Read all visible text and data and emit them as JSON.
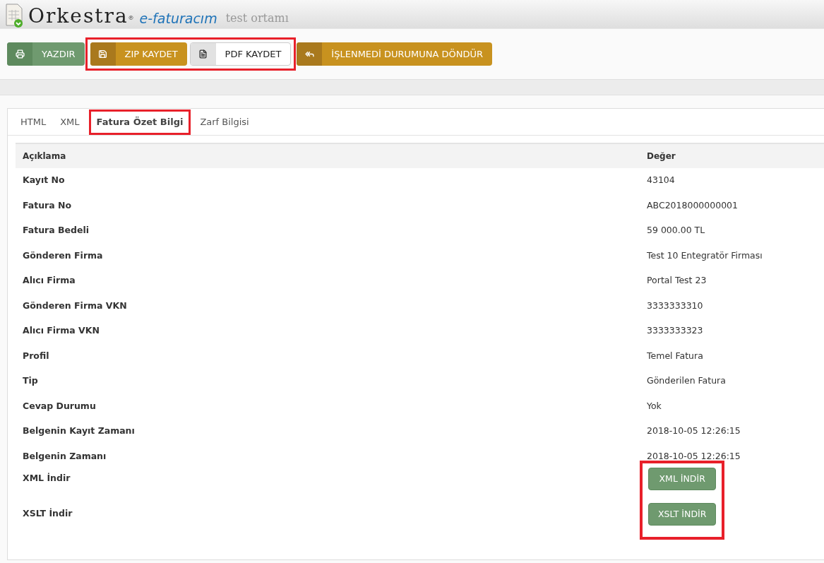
{
  "header": {
    "logo": "Orkestra",
    "logo_mark": "®",
    "product": "e-faturacım",
    "environment": "test ortamı"
  },
  "toolbar": [
    {
      "label": "YAZDIR",
      "kind": "print",
      "highlighted": false
    },
    {
      "label": "ZIP KAYDET",
      "kind": "save",
      "highlighted": true
    },
    {
      "label": "PDF KAYDET",
      "kind": "pdf",
      "highlighted": true
    },
    {
      "label": "İŞLENMEDİ DURUMUNA DÖNDÜR",
      "kind": "revert",
      "highlighted": false
    }
  ],
  "tabs": [
    {
      "label": "HTML",
      "selected": false,
      "highlighted": false
    },
    {
      "label": "XML",
      "selected": false,
      "highlighted": false
    },
    {
      "label": "Fatura Özet Bilgi",
      "selected": true,
      "highlighted": true
    },
    {
      "label": "Zarf Bilgisi",
      "selected": false,
      "highlighted": false
    }
  ],
  "table": {
    "columns": [
      "Açıklama",
      "Değer"
    ],
    "rows": [
      [
        "Kayıt No",
        "43104"
      ],
      [
        "Fatura No",
        "ABC2018000000001"
      ],
      [
        "Fatura Bedeli",
        "59 000.00 TL"
      ],
      [
        "Gönderen Firma",
        "Test 10 Entegratör Firması"
      ],
      [
        "Alıcı Firma",
        "Portal Test 23"
      ],
      [
        "Gönderen Firma VKN",
        "3333333310"
      ],
      [
        "Alıcı Firma VKN",
        "3333333323"
      ],
      [
        "Profil",
        "Temel Fatura"
      ],
      [
        "Tip",
        "Gönderilen Fatura"
      ],
      [
        "Cevap Durumu",
        "Yok"
      ],
      [
        "Belgenin Kayıt Zamanı",
        "2018-10-05 12:26:15"
      ],
      [
        "Belgenin Zamanı",
        "2018-10-05 12:26:15"
      ]
    ],
    "downloads": {
      "highlighted": true,
      "items": [
        {
          "label": "XML İndir",
          "button": "XML İNDİR"
        },
        {
          "label": "XSLT İndir",
          "button": "XSLT İNDİR"
        }
      ]
    }
  }
}
